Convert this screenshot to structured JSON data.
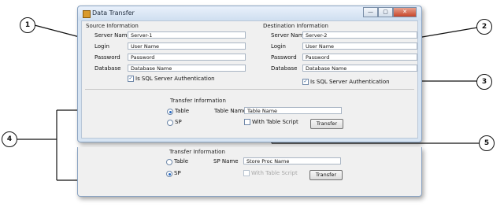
{
  "window": {
    "title": "Data Transfer",
    "buttons": [
      "—",
      "▢",
      "✕"
    ]
  },
  "source": {
    "title": "Source Information",
    "server_name_label": "Server Name",
    "server_name": "Server-1",
    "login_label": "Login",
    "login": "User Name",
    "password_label": "Password",
    "password": "Password",
    "database_label": "Database",
    "database": "Database Name",
    "sql_auth_label": "Is SQL Server Authentication"
  },
  "destination": {
    "title": "Destination Information",
    "server_name_label": "Server Name",
    "server_name": "Server-2",
    "login_label": "Login",
    "login": "User Name",
    "password_label": "Password",
    "password": "Password",
    "database_label": "Database",
    "database": "Database Name",
    "sql_auth_label": "Is SQL Server Authentication"
  },
  "transfer_top": {
    "title": "Transfer Information",
    "table_radio": "Table",
    "sp_radio": "SP",
    "name_label": "Table Name",
    "name_value": "Table Name",
    "script_label": "With Table Script",
    "transfer_button": "Transfer"
  },
  "transfer_bottom": {
    "title": "Transfer Information",
    "table_radio": "Table",
    "sp_radio": "SP",
    "name_label": "SP Name",
    "name_value": "Store Proc Name",
    "script_label": "With Table Script",
    "transfer_button": "Transfer"
  },
  "callouts": [
    "1",
    "2",
    "3",
    "4",
    "5"
  ]
}
